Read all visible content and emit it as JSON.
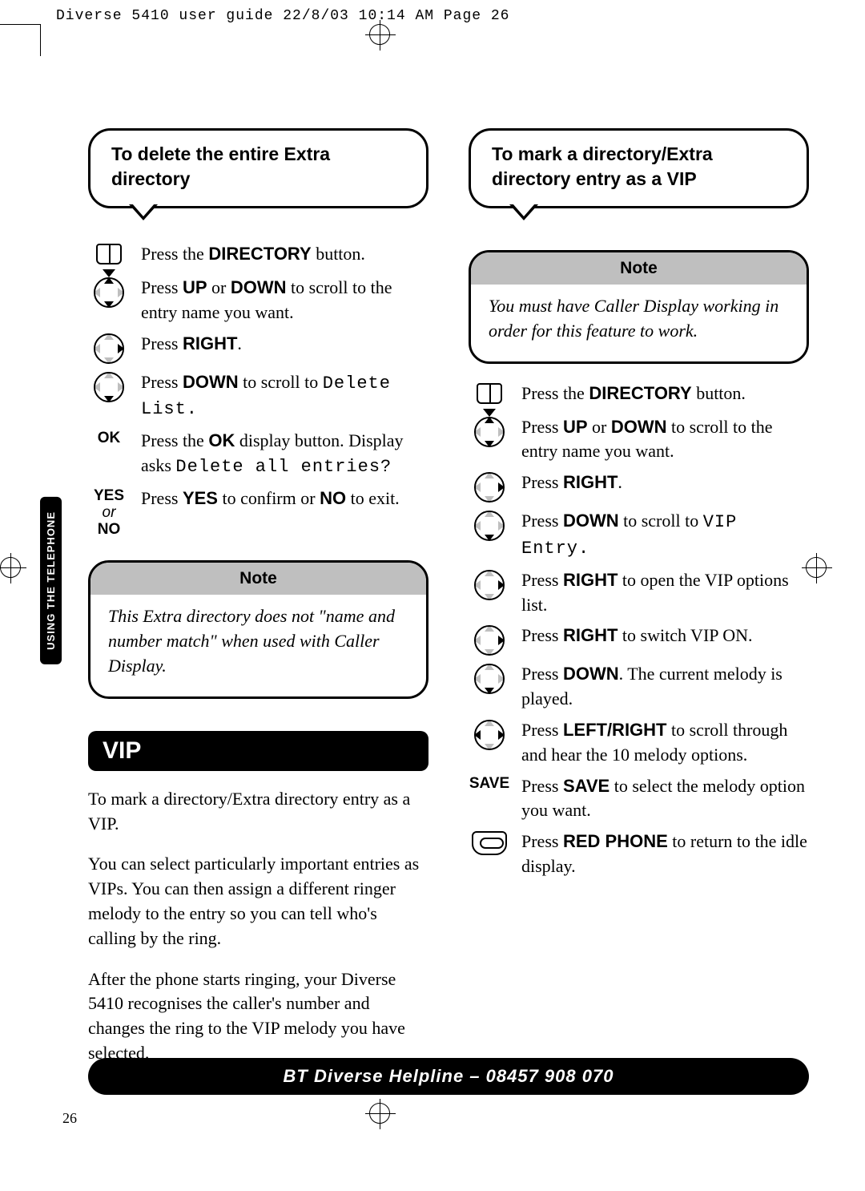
{
  "header_line": "Diverse 5410 user guide  22/8/03  10:14 AM  Page 26",
  "side_tab": "USING THE TELEPHONE",
  "page_number": "26",
  "helpline": "BT Diverse Helpline – 08457 908 070",
  "left": {
    "bubble": "To delete the entire Extra directory",
    "steps": {
      "s1": "Press the <b>DIRECTORY</b> button.",
      "s2": "Press <b>UP</b> or <b>DOWN</b> to scroll to the entry name you want.",
      "s3": "Press <b>RIGHT</b>.",
      "s4a": "Press <b>DOWN</b> to scroll to ",
      "s4b": "Delete List.",
      "s5_label": "OK",
      "s5a": "Press the <b>OK</b> display button. Display asks ",
      "s5b": "Delete all entries?",
      "s6_label_a": "YES",
      "s6_label_or": "or",
      "s6_label_b": "NO",
      "s6": "Press <b>YES</b> to confirm or <b>NO</b> to exit."
    },
    "note_title": "Note",
    "note_body": "This Extra directory does not \"name and number match\" when used with Caller Display.",
    "vip_heading": "VIP",
    "vip_p1": "To mark a directory/Extra directory entry as a VIP.",
    "vip_p2": "You can select particularly important entries as VIPs. You can then assign a different ringer melody to the entry so you can tell who's calling by the ring.",
    "vip_p3": "After the phone starts ringing, your Diverse 5410 recognises the caller's number and changes the ring to the VIP melody you have selected."
  },
  "right": {
    "bubble": "To mark a directory/Extra directory entry as a VIP",
    "note_title": "Note",
    "note_body": "You must have Caller Display working in order for this feature to work.",
    "steps": {
      "s1": "Press the <b>DIRECTORY</b> button.",
      "s2": "Press <b>UP</b> or <b>DOWN</b> to scroll to the entry name you want.",
      "s3": "Press <b>RIGHT</b>.",
      "s4a": "Press <b>DOWN</b> to scroll to ",
      "s4b": "VIP Entry.",
      "s5": "Press <b>RIGHT</b> to open the VIP options list.",
      "s6": "Press <b>RIGHT</b> to switch VIP ON.",
      "s7": "Press <b>DOWN</b>. The current melody is played.",
      "s8": "Press <b>LEFT/RIGHT</b> to scroll through and hear the 10 melody options.",
      "s9_label": "SAVE",
      "s9": "Press <b>SAVE</b> to select the melody option you want.",
      "s10": "Press <b>RED PHONE</b> to return to the idle display."
    }
  }
}
